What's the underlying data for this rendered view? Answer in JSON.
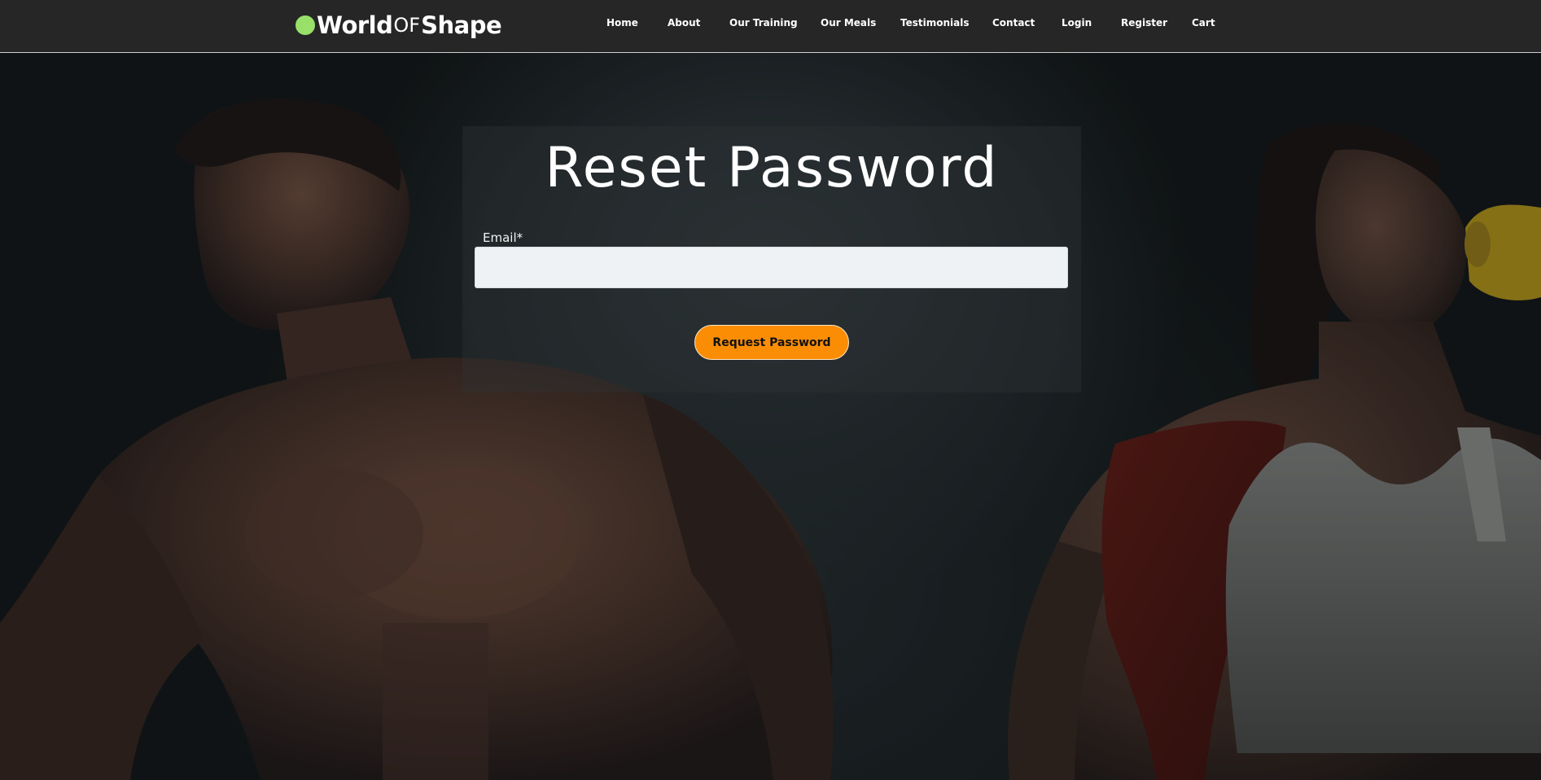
{
  "header": {
    "logo": {
      "part1": "World",
      "part2": "OF",
      "part3": "Shape"
    },
    "nav": [
      {
        "label": "Home"
      },
      {
        "label": "About"
      },
      {
        "label": "Our Training"
      },
      {
        "label": "Our Meals"
      },
      {
        "label": "Testimonials"
      },
      {
        "label": "Contact"
      },
      {
        "label": "Login"
      },
      {
        "label": "Register"
      },
      {
        "label": "Cart"
      }
    ]
  },
  "reset_form": {
    "title": "Reset Password",
    "email_label": "Email*",
    "email_value": "",
    "submit_label": "Request Password"
  },
  "colors": {
    "accent": "#fb8d05",
    "logo_dot": "#98e06a",
    "header_bg": "#262626",
    "input_bg": "#eef2f5"
  },
  "background": {
    "description_icon": "fitness-photo-background"
  }
}
